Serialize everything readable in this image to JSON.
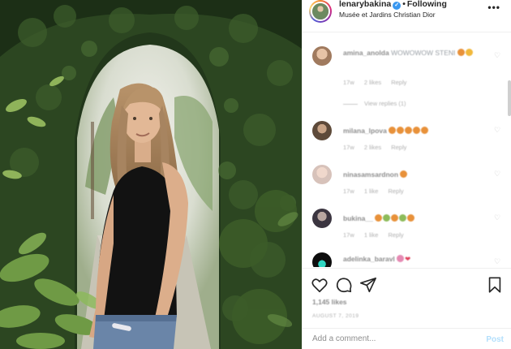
{
  "header": {
    "username": "lenarybakina",
    "verified_icon": "verified-badge-icon",
    "separator": "•",
    "follow_status": "Following",
    "location": "Musée et Jardins Christian Dior",
    "more_icon": "•••"
  },
  "comments": [
    {
      "username": "amina_anolda",
      "text": "WOWOWOW STENI",
      "time": "17w",
      "likes": "2 likes",
      "reply": "Reply"
    },
    {
      "username": "milana_lpova",
      "text": "",
      "time": "17w",
      "likes": "2 likes",
      "reply": "Reply"
    },
    {
      "username": "ninasamsardnon",
      "text": "",
      "time": "17w",
      "likes": "1 like",
      "reply": "Reply"
    },
    {
      "username": "bukina__",
      "text": "",
      "time": "17w",
      "likes": "1 like",
      "reply": "Reply"
    },
    {
      "username": "adelinka_baravl",
      "text": "",
      "time": "",
      "likes": "",
      "reply": ""
    }
  ],
  "view_replies": "View replies (1)",
  "actions": {
    "like_icon": "heart-icon",
    "comment_icon": "comment-icon",
    "share_icon": "share-icon",
    "save_icon": "bookmark-icon"
  },
  "likes_count": "1,145 likes",
  "post_date": "AUGUST 7, 2019",
  "add_comment": {
    "placeholder": "Add a comment...",
    "post_label": "Post"
  },
  "colors": {
    "accent": "#3897f0",
    "post_disabled": "#b2dffc",
    "text": "#262626",
    "muted": "#8e8e8e"
  }
}
